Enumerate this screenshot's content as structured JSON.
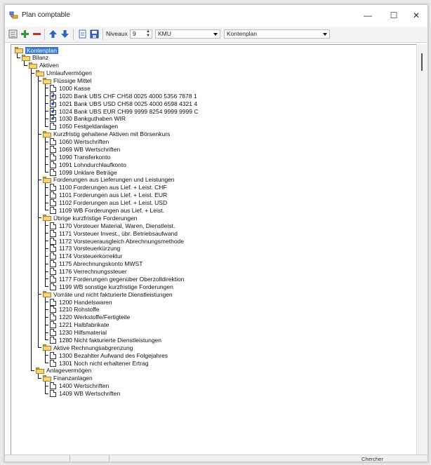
{
  "window": {
    "title": "Plan comptable",
    "controls": {
      "minimize": "—",
      "maximize": "☐",
      "close": "✕"
    }
  },
  "toolbar": {
    "niveaux_label": "Niveaux",
    "niveaux_value": "9",
    "scheme_value": "KMU",
    "view_value": "Kontenplan",
    "icons": [
      "tree-view-icon",
      "add-green-icon",
      "remove-red-icon",
      "move-up-icon",
      "move-down-icon",
      "document-icon",
      "save-icon"
    ]
  },
  "status": {
    "search_label": "Chercher"
  },
  "tree": {
    "selected": "Kontenplan",
    "rows": [
      {
        "level": 0,
        "type": "folder",
        "label": "Kontenplan"
      },
      {
        "level": 1,
        "type": "folder",
        "label": "Bilanz"
      },
      {
        "level": 2,
        "type": "folder",
        "label": "Aktiven"
      },
      {
        "level": 3,
        "type": "folder",
        "label": "Umlaufvermögen"
      },
      {
        "level": 4,
        "type": "folder",
        "label": "Flüssige Mittel"
      },
      {
        "level": 5,
        "type": "doc",
        "label": "1000 Kasse"
      },
      {
        "level": 5,
        "type": "bank",
        "label": "1020 Bank UBS CHF CH58 0025 4000 5356 7878 1"
      },
      {
        "level": 5,
        "type": "bank",
        "label": "1021 Bank UBS USD CH58 0025 4000 6598 4321 4"
      },
      {
        "level": 5,
        "type": "bank",
        "label": "1024 Bank UBS EUR CH99 9999  8254 9999 9999 C"
      },
      {
        "level": 5,
        "type": "bank",
        "label": "1030 Bankguthaben WIR"
      },
      {
        "level": 5,
        "type": "doc",
        "label": "1050 Festgeldanlagen"
      },
      {
        "level": 4,
        "type": "folder",
        "label": "Kurzfristig gehaltene Aktiven mit Börsenkurs"
      },
      {
        "level": 5,
        "type": "doc",
        "label": "1060 Wertschriften"
      },
      {
        "level": 5,
        "type": "doc",
        "label": "1069 WB Wertschriften"
      },
      {
        "level": 5,
        "type": "doc",
        "label": "1090 Transferkonto"
      },
      {
        "level": 5,
        "type": "doc",
        "label": "1091 Lohndurchlaufkonto"
      },
      {
        "level": 5,
        "type": "doc",
        "label": "1099 Unklare Beträge"
      },
      {
        "level": 4,
        "type": "folder",
        "label": "Forderungen aus Lieferungen und Leistungen"
      },
      {
        "level": 5,
        "type": "doc",
        "label": "1100 Forderungen aus Lief. + Leist. CHF"
      },
      {
        "level": 5,
        "type": "doc",
        "label": "1101 Forderungen aus Lief. + Leist. EUR"
      },
      {
        "level": 5,
        "type": "doc",
        "label": "1102 Forderungen aus Lief. + Leist. USD"
      },
      {
        "level": 5,
        "type": "doc",
        "label": "1109 WB Forderungen aus Lief. + Leist."
      },
      {
        "level": 4,
        "type": "folder",
        "label": "Übrige kurzfristige Forderungen"
      },
      {
        "level": 5,
        "type": "doc",
        "label": "1170 Vorsteuer Material, Waren, Dienstleist."
      },
      {
        "level": 5,
        "type": "doc",
        "label": "1171 Vorsteuer Invest., übr. Betriebsaufwand"
      },
      {
        "level": 5,
        "type": "doc",
        "label": "1172 Vorsteuerausgleich Abrechnungsmethode"
      },
      {
        "level": 5,
        "type": "doc",
        "label": "1173 Vorsteuerkürzung"
      },
      {
        "level": 5,
        "type": "doc",
        "label": "1174 Vorsteuerkorrektur"
      },
      {
        "level": 5,
        "type": "doc",
        "label": "1175 Abrechnungskonto MWST"
      },
      {
        "level": 5,
        "type": "doc",
        "label": "1176 Verrechnungssteuer"
      },
      {
        "level": 5,
        "type": "doc",
        "label": "1177 Forderungen gegenüber Oberzolldirektion"
      },
      {
        "level": 5,
        "type": "doc",
        "label": "1199 WB sonstige kurzfristige Forderungen"
      },
      {
        "level": 4,
        "type": "folder",
        "label": "Vorräte und nicht fakturierte Dienstleistungen"
      },
      {
        "level": 5,
        "type": "doc",
        "label": "1200 Handelswaren"
      },
      {
        "level": 5,
        "type": "doc",
        "label": "1210 Rohstoffe"
      },
      {
        "level": 5,
        "type": "doc",
        "label": "1220 Werkstoffe/Fertigteile"
      },
      {
        "level": 5,
        "type": "doc",
        "label": "1221 Halbfabrikate"
      },
      {
        "level": 5,
        "type": "doc",
        "label": "1230 Hilfsmaterial"
      },
      {
        "level": 5,
        "type": "doc",
        "label": "1280 Nicht fakturierte Dienstleistungen"
      },
      {
        "level": 4,
        "type": "folder",
        "label": "Aktive Rechnungsabgrenzung"
      },
      {
        "level": 5,
        "type": "doc",
        "label": "1300 Bezahlter Aufwand des Folgejahres"
      },
      {
        "level": 5,
        "type": "doc",
        "label": "1301 Noch nicht erhaltener Ertrag"
      },
      {
        "level": 3,
        "type": "folder",
        "label": "Anlagevermögen"
      },
      {
        "level": 4,
        "type": "folder",
        "label": "Finanzanlagen"
      },
      {
        "level": 5,
        "type": "doc",
        "label": "1400 Wertschriften"
      },
      {
        "level": 5,
        "type": "doc",
        "label": "1409 WB Wertschriften"
      }
    ]
  }
}
